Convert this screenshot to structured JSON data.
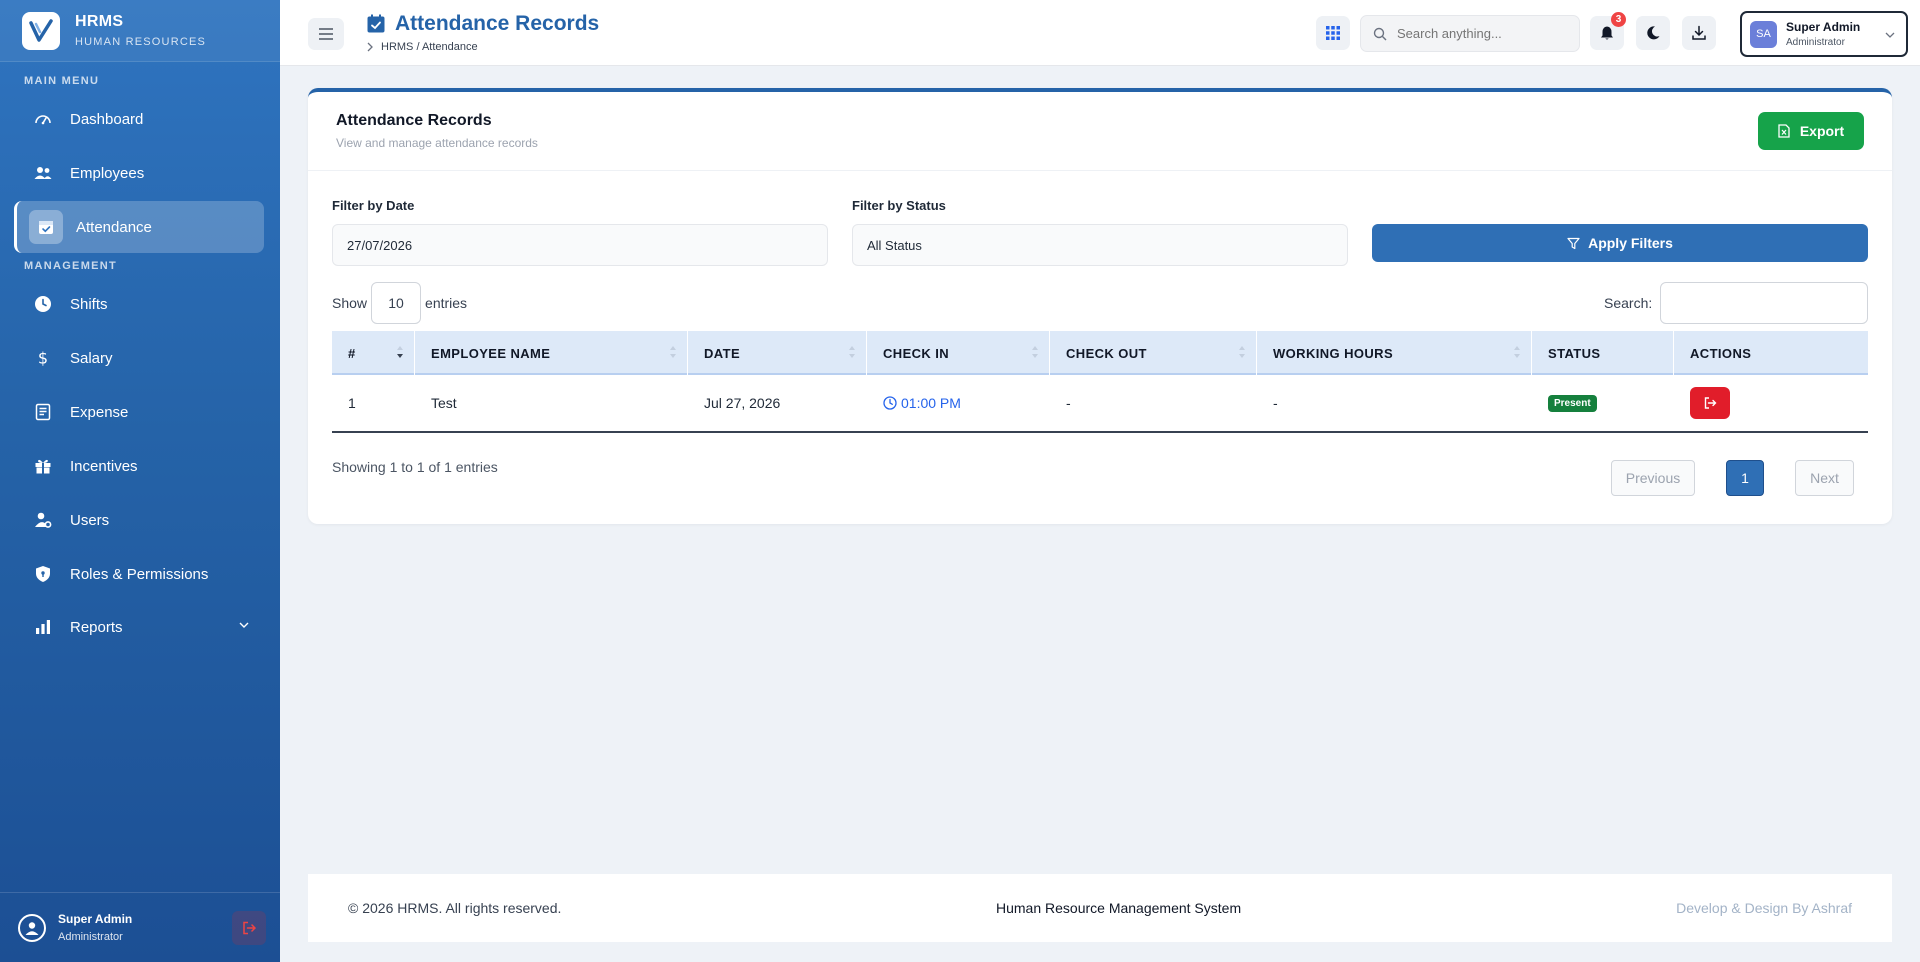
{
  "brand": {
    "name": "HRMS",
    "subtitle": "HUMAN RESOURCES"
  },
  "sidebar": {
    "main_menu_title": "MAIN MENU",
    "management_title": "MANAGEMENT",
    "items": [
      {
        "label": "Dashboard",
        "icon": "dashboard-icon"
      },
      {
        "label": "Employees",
        "icon": "users-icon"
      },
      {
        "label": "Attendance",
        "icon": "calendar-check-icon",
        "active": true
      },
      {
        "label": "Shifts",
        "icon": "clock-icon"
      },
      {
        "label": "Salary",
        "icon": "dollar-icon"
      },
      {
        "label": "Expense",
        "icon": "receipt-icon"
      },
      {
        "label": "Incentives",
        "icon": "gift-icon"
      },
      {
        "label": "Users",
        "icon": "user-gear-icon"
      },
      {
        "label": "Roles & Permissions",
        "icon": "shield-icon"
      },
      {
        "label": "Reports",
        "icon": "bar-chart-icon"
      }
    ],
    "user": {
      "name": "Super Admin",
      "role": "Administrator"
    }
  },
  "header": {
    "title": "Attendance Records",
    "breadcrumb": "HRMS / Attendance",
    "search_placeholder": "Search anything...",
    "notification_count": "3",
    "user": {
      "initials": "SA",
      "name": "Super Admin",
      "role": "Administrator"
    }
  },
  "card": {
    "title": "Attendance Records",
    "subtitle": "View and manage attendance records",
    "export_label": "Export",
    "filter_date_label": "Filter by Date",
    "filter_date_value": "27/07/2026",
    "filter_status_label": "Filter by Status",
    "filter_status_value": "All Status",
    "apply_label": "Apply Filters",
    "show_label": "Show",
    "show_value": "10",
    "entries_label": "entries",
    "search_label": "Search:"
  },
  "table": {
    "columns": [
      "#",
      "EMPLOYEE NAME",
      "DATE",
      "CHECK IN",
      "CHECK OUT",
      "WORKING HOURS",
      "STATUS",
      "ACTIONS"
    ],
    "rows": [
      {
        "num": "1",
        "name": "Test",
        "date": "Jul 27, 2026",
        "check_in": "01:00 PM",
        "check_out": "-",
        "hours": "-",
        "status": "Present"
      }
    ]
  },
  "pagination": {
    "info": "Showing 1 to 1 of 1 entries",
    "previous": "Previous",
    "current": "1",
    "next": "Next"
  },
  "footer": {
    "copyright": "© 2026 HRMS. All rights reserved.",
    "center": "Human Resource Management System",
    "credit": "Develop & Design By Ashraf"
  },
  "colors": {
    "primary": "#2563a8",
    "success": "#16a34a",
    "danger": "#e11d2a"
  }
}
